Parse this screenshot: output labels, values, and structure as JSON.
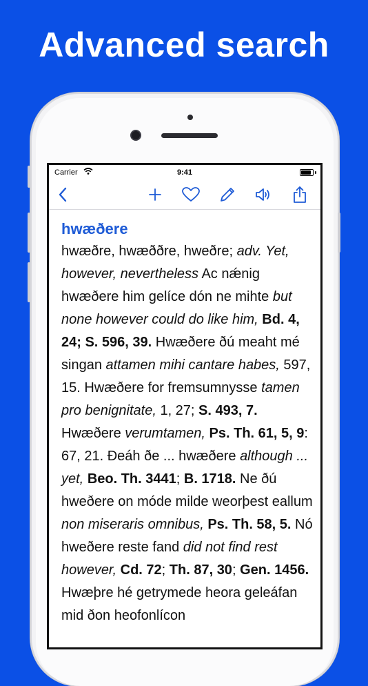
{
  "headline": "Advanced search",
  "status_bar": {
    "carrier": "Carrier",
    "time": "9:41"
  },
  "icons": {
    "back": "chevron-left-icon",
    "add": "plus-icon",
    "favorite": "heart-icon",
    "edit": "pencil-icon",
    "speak": "speaker-icon",
    "share": "share-icon"
  },
  "colors": {
    "background": "#0b50e6",
    "accent": "#1e5bd6"
  },
  "entry": {
    "headword": "hwæðere",
    "segments": [
      {
        "s": "hwæðre, hwæððre, hweðre; ",
        "t": "n"
      },
      {
        "s": "adv. Yet, however, nevertheless",
        "t": "i"
      },
      {
        "s": " Ac nǽnig hwæðere him gelíce dón ne mihte ",
        "t": "n"
      },
      {
        "s": "but none however could do like him,",
        "t": "i"
      },
      {
        "s": " ",
        "t": "n"
      },
      {
        "s": "Bd. 4, 24; S. 596, 39.",
        "t": "b"
      },
      {
        "s": " Hwæðere ðú meaht mé singan ",
        "t": "n"
      },
      {
        "s": "attamen mihi cantare habes,",
        "t": "i"
      },
      {
        "s": " 597, 15. Hwæðere for fremsumnysse ",
        "t": "n"
      },
      {
        "s": "tamen pro benignitate,",
        "t": "i"
      },
      {
        "s": " 1, 27; ",
        "t": "n"
      },
      {
        "s": "S. 493, 7.",
        "t": "b"
      },
      {
        "s": " Hwæðere ",
        "t": "n"
      },
      {
        "s": "verumtamen,",
        "t": "i"
      },
      {
        "s": " ",
        "t": "n"
      },
      {
        "s": "Ps. Th. 61, 5, 9",
        "t": "b"
      },
      {
        "s": ": 67, 21. Ðeáh ðe ... hwæðere ",
        "t": "n"
      },
      {
        "s": "although ... yet,",
        "t": "i"
      },
      {
        "s": " ",
        "t": "n"
      },
      {
        "s": "Beo. Th. 3441",
        "t": "b"
      },
      {
        "s": "; ",
        "t": "n"
      },
      {
        "s": "B. 1718.",
        "t": "b"
      },
      {
        "s": " Ne ðú hweðere on móde milde weorþest eallum ",
        "t": "n"
      },
      {
        "s": "non miseraris omnibus,",
        "t": "i"
      },
      {
        "s": " ",
        "t": "n"
      },
      {
        "s": "Ps. Th. 58, 5.",
        "t": "b"
      },
      {
        "s": " Nó hweðere reste fand ",
        "t": "n"
      },
      {
        "s": "did not find rest however,",
        "t": "i"
      },
      {
        "s": " ",
        "t": "n"
      },
      {
        "s": "Cd. 72",
        "t": "b"
      },
      {
        "s": "; ",
        "t": "n"
      },
      {
        "s": "Th. 87, 30",
        "t": "b"
      },
      {
        "s": "; ",
        "t": "n"
      },
      {
        "s": "Gen. 1456.",
        "t": "b"
      },
      {
        "s": " Hwæþre hé getrymede heora geleáfan mid ðon heofonlícon",
        "t": "n"
      }
    ]
  }
}
